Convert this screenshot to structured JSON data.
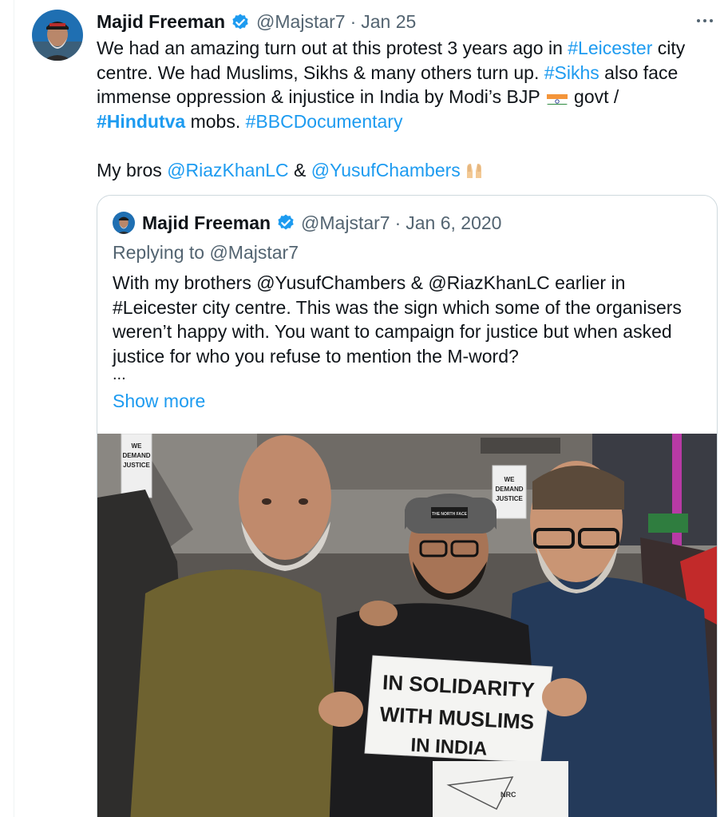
{
  "tweet": {
    "author_name": "Majid Freeman",
    "handle": "@Majstar7",
    "separator": "·",
    "date": "Jan 25",
    "more_icon": "more-horizontal-icon",
    "text": {
      "l1_a": "We had an amazing turn out at this protest 3 years ago in ",
      "l1_link": "#Leicester",
      "l1_b": " city",
      "l2_a": "centre. We had Muslims, Sikhs & many others turn up. ",
      "l2_link": "#Sikhs",
      "l2_b": " also face",
      "l3_a": "immense oppression & injustice in India by Modi’s BJP ",
      "l3_b": " govt /",
      "l4_link": "#Hindutva",
      "l4_a": " mobs. ",
      "l4_link2": "#BBCDocumentary",
      "l5_a": "My bros ",
      "l5_link1": "@RiazKhanLC",
      "l5_b": " & ",
      "l5_link2": "@YusufChambers"
    }
  },
  "quote": {
    "author_name": "Majid Freeman",
    "handle": "@Majstar7",
    "separator": "·",
    "date": "Jan 6, 2020",
    "replying_to": "Replying to @Majstar7",
    "lines": [
      "With my brothers @YusufChambers & @RiazKhanLC earlier in",
      "#Leicester city centre. This was the sign which some of the organisers",
      "weren’t happy with. You want to campaign for justice but when asked",
      "justice for who you refuse to mention the M-word?"
    ],
    "ellipsis": "...",
    "show_more": "Show more"
  },
  "photo": {
    "sign_lines": [
      "IN SOLIDARITY",
      "WITH MUSLIMS",
      "IN INDIA"
    ],
    "placard_left": [
      "WE",
      "DEMAND",
      "JUSTICE"
    ],
    "placard_right": [
      "WE",
      "DEMAND",
      "JUSTICE"
    ],
    "beanie_logo": "THE NORTH FACE",
    "lower_sign_text": "NRC"
  },
  "colors": {
    "link": "#1d9bf0",
    "secondary_text": "#536471",
    "verified": "#1d9bf0",
    "border": "#cfd9de"
  }
}
